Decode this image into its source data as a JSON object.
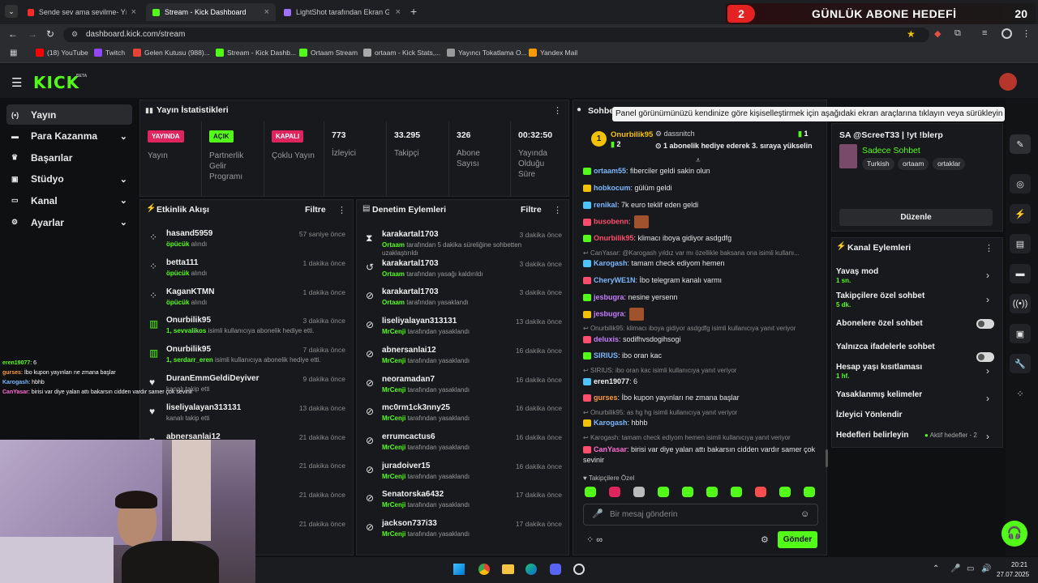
{
  "browser": {
    "tabs": [
      {
        "title": "Sende sev ama sevilme- Yıldız",
        "color": "#ff2a2a"
      },
      {
        "title": "Stream - Kick Dashboard",
        "color": "#53fc18"
      },
      {
        "title": "LightShot tarafından Ekran Gö",
        "color": "#a070ff"
      }
    ],
    "url": "dashboard.kick.com/stream",
    "bookmarks": [
      "(18) YouTube",
      "Twitch",
      "Gelen Kutusu (988)...",
      "Stream - Kick Dashb...",
      "Ortaam Stream",
      "ortaam - Kick Stats,...",
      "Yayıncı Tokatlama O...",
      "Yandex Mail"
    ]
  },
  "overlay": {
    "goal_title": "GÜNLÜK ABONE HEDEFİ",
    "goal_current": "2",
    "goal_target": "20"
  },
  "kick": {
    "logo": "KICK",
    "beta": "BETA"
  },
  "sidebar": {
    "items": [
      {
        "label": "Yayın",
        "icon": "stream-icon"
      },
      {
        "label": "Para Kazanma",
        "icon": "money-icon"
      },
      {
        "label": "Başarılar",
        "icon": "trophy-icon"
      },
      {
        "label": "Stüdyo",
        "icon": "studio-icon"
      },
      {
        "label": "Kanal",
        "icon": "channel-icon"
      },
      {
        "label": "Ayarlar",
        "icon": "gear-icon"
      }
    ]
  },
  "stats": {
    "title": "Yayın İstatistikleri",
    "cells": [
      {
        "badge": "YAYINDA",
        "label": "Yayın",
        "badge_color": "#e0245e"
      },
      {
        "badge": "AÇIK",
        "label": "Partnerlik Gelir Programı",
        "badge_color": "#53fc18"
      },
      {
        "badge": "KAPALI",
        "label": "Çoklu Yayın",
        "badge_color": "#e0245e"
      },
      {
        "value": "773",
        "label": "İzleyici"
      },
      {
        "value": "33.295",
        "label": "Takipçi"
      },
      {
        "value": "326",
        "label": "Abone Sayısı"
      },
      {
        "value": "00:32:50",
        "label": "Yayında Olduğu Süre"
      }
    ]
  },
  "activity": {
    "title": "Etkinlik Akışı",
    "filter": "Filtre",
    "rows": [
      {
        "name": "hasand5959",
        "sub_hl": "öpücük",
        "sub": " alındı",
        "time": "57 saniye önce",
        "icon": "heart"
      },
      {
        "name": "betta111",
        "sub_hl": "öpücük",
        "sub": " alındı",
        "time": "1 dakika önce",
        "icon": "heart"
      },
      {
        "name": "KaganKTMN",
        "sub_hl": "öpücük",
        "sub": " alındı",
        "time": "1 dakika önce",
        "icon": "heart"
      },
      {
        "name": "Onurbilik95",
        "sub_hl": "1, sevvalikos",
        "sub": " isimli kullanıcıya abonelik hediye etti.",
        "time": "3 dakika önce",
        "icon": "gift"
      },
      {
        "name": "Onurbilik95",
        "sub_hl": "1, serdarr_eren",
        "sub": " isimli kullanıcıya abonelik hediye etti.",
        "time": "7 dakika önce",
        "icon": "gift"
      },
      {
        "name": "DuranEmmGeldiDeyiver",
        "sub_hl": "",
        "sub": "kanalı takip etti",
        "time": "9 dakika önce",
        "icon": "follow"
      },
      {
        "name": "liseliyalayan313131",
        "sub_hl": "",
        "sub": "kanalı takip etti",
        "time": "13 dakika önce",
        "icon": "follow"
      },
      {
        "name": "abnersanlai12",
        "sub_hl": "",
        "sub": "",
        "time": "21 dakika önce",
        "icon": "follow"
      }
    ],
    "hidden_times": [
      "21 dakika önce",
      "21 dakika önce",
      "21 dakika önce"
    ]
  },
  "moderation": {
    "title": "Denetim Eylemleri",
    "filter": "Filtre",
    "rows": [
      {
        "name": "karakartal1703",
        "mod": "Ortaam",
        "action": " tarafından 5 dakika süreliğine sohbetten uzaklaştırıldı",
        "time": "3 dakika önce",
        "icon": "timeout"
      },
      {
        "name": "karakartal1703",
        "mod": "Ortaam",
        "action": " tarafından yasağı kaldırıldı",
        "time": "3 dakika önce",
        "icon": "unban"
      },
      {
        "name": "karakartal1703",
        "mod": "Ortaam",
        "action": " tarafından yasaklandı",
        "time": "3 dakika önce",
        "icon": "ban"
      },
      {
        "name": "liseliyalayan313131",
        "mod": "MrCenji",
        "action": " tarafından yasaklandı",
        "time": "13 dakika önce",
        "icon": "ban"
      },
      {
        "name": "abnersanlai12",
        "mod": "MrCenji",
        "action": " tarafından yasaklandı",
        "time": "16 dakika önce",
        "icon": "ban"
      },
      {
        "name": "neoramadan7",
        "mod": "MrCenji",
        "action": " tarafından yasaklandı",
        "time": "16 dakika önce",
        "icon": "ban"
      },
      {
        "name": "mc0rm1ck3nny25",
        "mod": "MrCenji",
        "action": " tarafından yasaklandı",
        "time": "16 dakika önce",
        "icon": "ban"
      },
      {
        "name": "errumcactus6",
        "mod": "MrCenji",
        "action": " tarafından yasaklandı",
        "time": "16 dakika önce",
        "icon": "ban"
      },
      {
        "name": "juradoiver15",
        "mod": "MrCenji",
        "action": " tarafından yasaklandı",
        "time": "16 dakika önce",
        "icon": "ban"
      },
      {
        "name": "Senatorska6432",
        "mod": "MrCenji",
        "action": " tarafından yasaklandı",
        "time": "17 dakika önce",
        "icon": "ban"
      },
      {
        "name": "jackson737i33",
        "mod": "MrCenji",
        "action": " tarafından yasaklandı",
        "time": "17 dakika önce",
        "icon": "ban"
      }
    ]
  },
  "chat": {
    "title": "Sohbet",
    "tooltip": "Panel görünümünüzü kendinize göre kişiselleştirmek için aşağıdaki ekran araçlarına tıklayın veya sürükleyin",
    "pinned": {
      "gifter": "Onurbilik95",
      "gift_count": "2",
      "user2": "dassnitch",
      "count2": "1",
      "message": "1 abonelik hediye ederek 3. sıraya yükselin"
    },
    "messages": [
      {
        "user": "ortaam55",
        "color": "#7ab7ff",
        "text": ": fiberciler geldi sakin olun"
      },
      {
        "user": "hobkocum",
        "color": "#7ab7ff",
        "text": ": gülüm geldi"
      },
      {
        "user": "renikal",
        "color": "#7ab7ff",
        "text": ": 7k euro teklif eden geldi"
      },
      {
        "user": "busobenn",
        "color": "#ff4d6d",
        "text": ":"
      },
      {
        "user": "Onurbilik95",
        "color": "#ff4d6d",
        "text": ": klimacı iboya gidiyor asdgdfg"
      },
      {
        "reply": "CanYasar: @Karogash yıldız var mı özellikle baksana ona isimli kullanı..."
      },
      {
        "user": "Karogash",
        "color": "#7ab7ff",
        "text": ": tamam check ediyom hemen"
      },
      {
        "user": "CheryWE1N",
        "color": "#7ab7ff",
        "text": ": İbo telegram kanalı varmı"
      },
      {
        "user": "jesbugra",
        "color": "#c77dff",
        "text": ": nesine yersenn"
      },
      {
        "user": "jesbugra",
        "color": "#c77dff",
        "text": ":"
      },
      {
        "reply": "Onurbilik95: klimacı iboya gidiyor asdgdfg isimli kullanıcıya yanıt veriyor"
      },
      {
        "user": "deluxis",
        "color": "#c77dff",
        "text": ": sodifhvsdogihsogi"
      },
      {
        "user": "SIRIUS",
        "color": "#7ab7ff",
        "text": ": ibo oran kac"
      },
      {
        "reply": "SIRIUS: ibo oran kac isimli kullanıcıya yanıt veriyor"
      },
      {
        "user": "eren19077",
        "color": "#f0f0f0",
        "text": ": 6"
      },
      {
        "user": "gurses",
        "color": "#ff9a3c",
        "text": ": İbo kupon yayınları ne zmana başlar"
      },
      {
        "reply": "Onurbilik95: as hg hg isimli kullanıcıya yanıt veriyor"
      },
      {
        "user": "Karogash",
        "color": "#7ab7ff",
        "text": ": hbhb"
      },
      {
        "reply": "Karogash: tamam check ediyom hemen isimli kullanıcıya yanıt veriyor"
      },
      {
        "user": "CanYasar",
        "color": "#ff6bd6",
        "text": ": birisi var diye yalan attı bakarsın cidden vardır samer çok sevinir"
      }
    ],
    "followers_only": "Takipçilere Özel",
    "input_placeholder": "Bir mesaj gönderin",
    "send_label": "Gönder"
  },
  "stream_info": {
    "title": "SA @ScreeT33 | !yt !blerp",
    "category": "Sadece Sohbet",
    "tags": [
      "Turkish",
      "ortaam",
      "ortaklar"
    ],
    "edit_label": "Düzenle"
  },
  "channel_actions": {
    "title": "Kanal Eylemleri",
    "items": [
      {
        "label": "Yavaş mod",
        "sub": "1 sn.",
        "ctrl": "chev"
      },
      {
        "label": "Takipçilere özel sohbet",
        "sub": "5 dk.",
        "ctrl": "chev"
      },
      {
        "label": "Abonelere özel sohbet",
        "sub": "",
        "ctrl": "toggle"
      },
      {
        "label": "Yalnızca ifadelerle sohbet",
        "sub": "",
        "ctrl": "toggle"
      },
      {
        "label": "Hesap yaşı kısıtlaması",
        "sub": "1 hf.",
        "ctrl": "chev"
      },
      {
        "label": "Yasaklanmış kelimeler",
        "sub": "",
        "ctrl": "chev"
      },
      {
        "label": "İzleyici Yönlendir",
        "sub": "",
        "ctrl": "none"
      },
      {
        "label": "Hedefleri belirleyin",
        "sub": "",
        "ctrl": "goal",
        "extra": "Aktif hedefler - 2"
      }
    ]
  },
  "overlay_chat": [
    {
      "user": "eren19077",
      "text": ": 6"
    },
    {
      "user": "gurses",
      "text": ": İbo kupon yayınları ne zmana başlar"
    },
    {
      "user": "Karogash",
      "text": ": hbhb"
    },
    {
      "user": "CanYasar",
      "text": ": birisi var diye yalan attı bakarsın cidden vardır samer çok sevinir"
    }
  ],
  "taskbar": {
    "time": "20:21",
    "date": "27.07.2025"
  }
}
